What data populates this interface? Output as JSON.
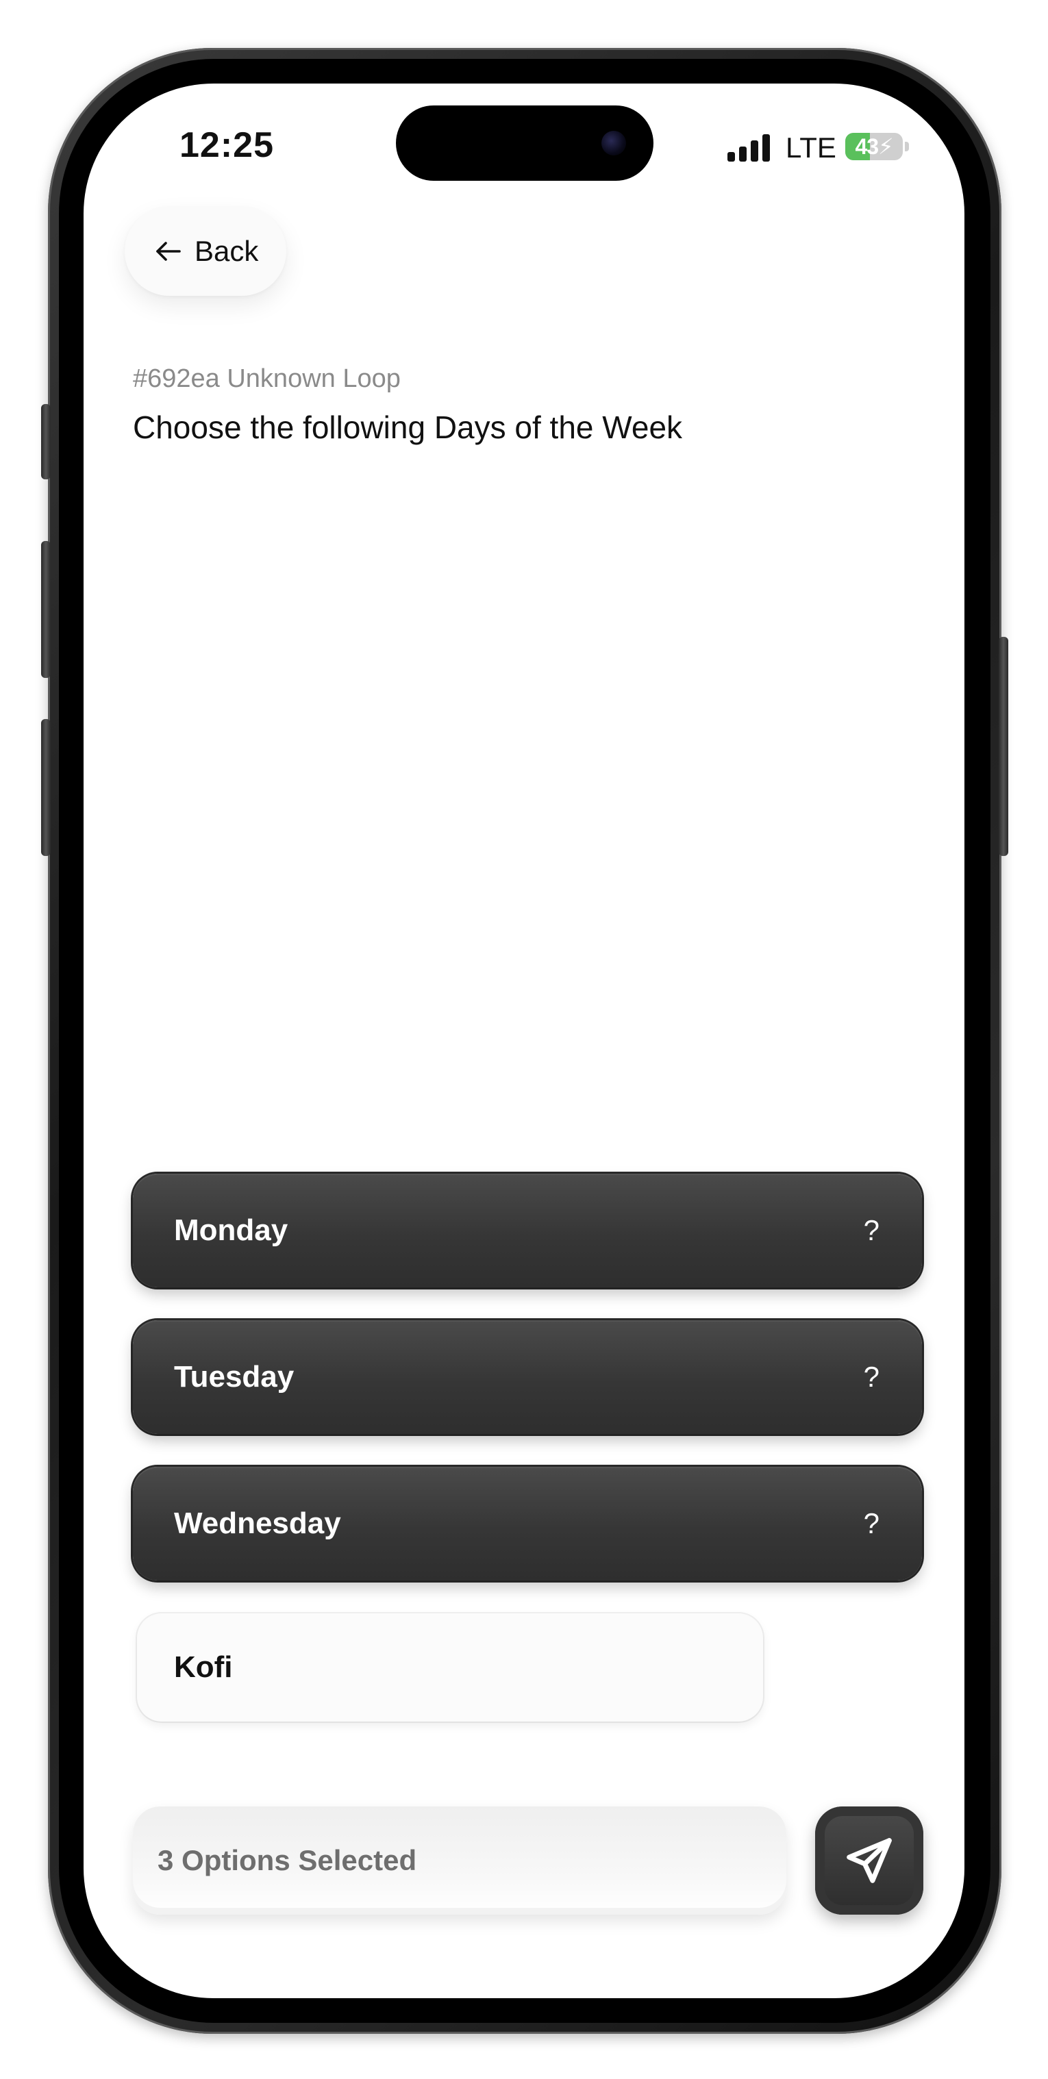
{
  "status_bar": {
    "time": "12:25",
    "network": "LTE",
    "battery_level": "43",
    "battery_fraction": 0.43,
    "battery_color": "#5ac05c",
    "signal_bars": 4
  },
  "nav": {
    "back_label": "Back",
    "back_icon": "arrow-left-icon"
  },
  "header": {
    "loop_id": "#692ea Unknown Loop",
    "question": "Choose the following Days of the Week"
  },
  "options": [
    {
      "label": "Monday",
      "hint": "?",
      "selected": true
    },
    {
      "label": "Tuesday",
      "hint": "?",
      "selected": true
    },
    {
      "label": "Wednesday",
      "hint": "?",
      "selected": true
    },
    {
      "label": "Kofi",
      "selected": false
    }
  ],
  "footer": {
    "selection_summary": "3 Options Selected",
    "send_icon": "paper-plane-icon"
  },
  "colors": {
    "selected_option_bg": "#3a3a3a",
    "unselected_option_bg": "#fbfbfb",
    "secondary_text": "#8a8a8a"
  }
}
